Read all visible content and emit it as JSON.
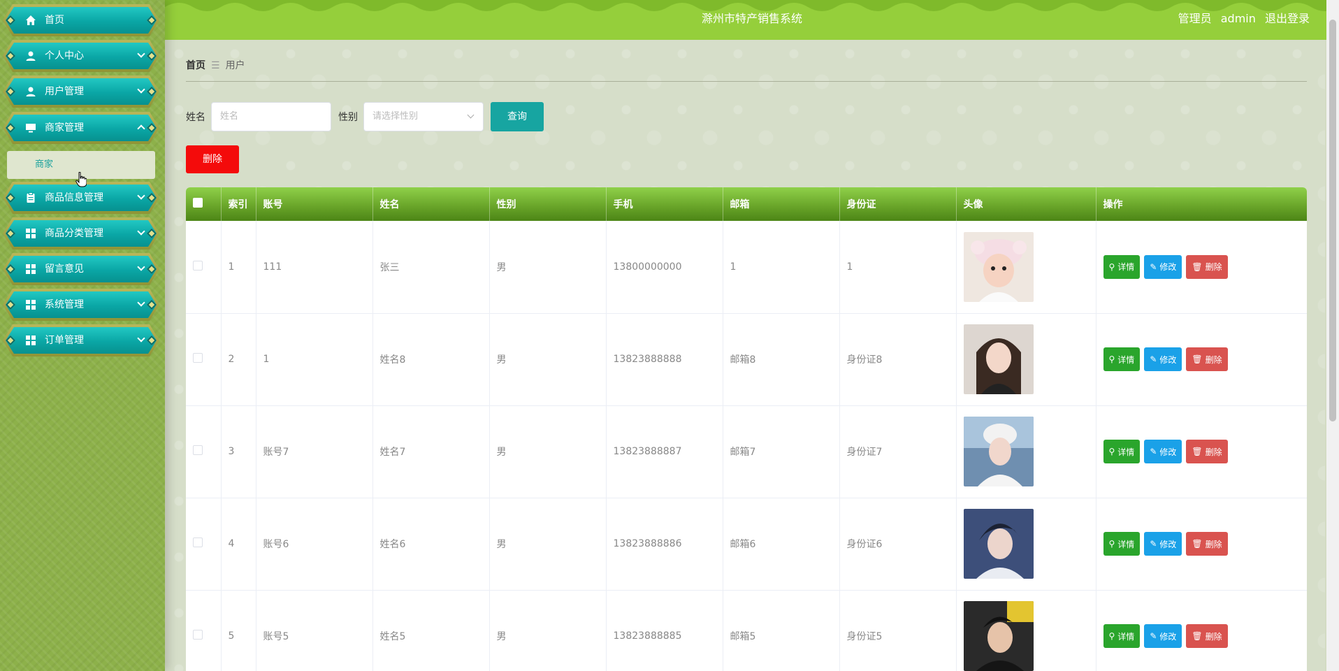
{
  "app": {
    "title": "滁州市特产销售系统",
    "role": "管理员",
    "user": "admin",
    "logout": "退出登录"
  },
  "sidebar": {
    "items": [
      {
        "label": "首页",
        "icon": "home-icon"
      },
      {
        "label": "个人中心",
        "icon": "user-icon"
      },
      {
        "label": "用户管理",
        "icon": "user-icon"
      },
      {
        "label": "商家管理",
        "icon": "monitor-icon",
        "expanded": true
      },
      {
        "label": "商品信息管理",
        "icon": "clipboard-icon"
      },
      {
        "label": "商品分类管理",
        "icon": "grid-icon"
      },
      {
        "label": "留言意见",
        "icon": "grid-icon"
      },
      {
        "label": "系统管理",
        "icon": "grid-icon"
      },
      {
        "label": "订单管理",
        "icon": "grid-icon"
      }
    ],
    "sub_item": "商家"
  },
  "breadcrumb": {
    "home": "首页",
    "sep": "☰",
    "current": "用户"
  },
  "search": {
    "name_label": "姓名",
    "name_placeholder": "姓名",
    "gender_label": "性别",
    "gender_placeholder": "请选择性别",
    "query_button": "查询"
  },
  "toolbar": {
    "delete_button": "删除"
  },
  "table": {
    "headers": [
      "",
      "索引",
      "账号",
      "姓名",
      "性别",
      "手机",
      "邮箱",
      "身份证",
      "头像",
      "操作"
    ],
    "rows": [
      {
        "index": "1",
        "account": "111",
        "name": "张三",
        "gender": "男",
        "phone": "13800000000",
        "email": "1",
        "idcard": "1"
      },
      {
        "index": "2",
        "account": "1",
        "name": "姓名8",
        "gender": "男",
        "phone": "13823888888",
        "email": "邮箱8",
        "idcard": "身份证8"
      },
      {
        "index": "3",
        "account": "账号7",
        "name": "姓名7",
        "gender": "男",
        "phone": "13823888887",
        "email": "邮箱7",
        "idcard": "身份证7"
      },
      {
        "index": "4",
        "account": "账号6",
        "name": "姓名6",
        "gender": "男",
        "phone": "13823888886",
        "email": "邮箱6",
        "idcard": "身份证6"
      },
      {
        "index": "5",
        "account": "账号5",
        "name": "姓名5",
        "gender": "男",
        "phone": "13823888885",
        "email": "邮箱5",
        "idcard": "身份证5"
      }
    ],
    "actions": {
      "detail": "详情",
      "edit": "修改",
      "delete": "删除"
    }
  },
  "colors": {
    "header_bg": "#95cf3b",
    "menu_teal": "#0aa6a5",
    "query_btn": "#17a5a1",
    "danger": "#f40b0b",
    "detail_btn": "#2aa52c",
    "edit_btn": "#1aa1e8",
    "row_delete_btn": "#d9534f"
  }
}
